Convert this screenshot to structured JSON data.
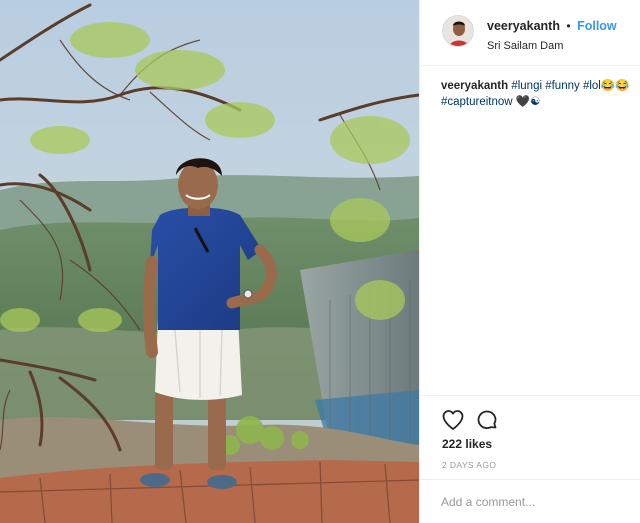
{
  "post": {
    "username": "veeryakanth",
    "separator": "•",
    "follow_label": "Follow",
    "location": "Sri Sailam Dam",
    "caption": {
      "username": "veeryakanth",
      "line1_tags": "#lungi #funny #lol😂😂",
      "line2_tags": "#captureitnow 🖤☯"
    },
    "likes": "222 likes",
    "date": "2 DAYS AGO",
    "comment_placeholder": "Add a comment..."
  },
  "icons": {
    "like": "heart-icon",
    "comment": "comment-bubble-icon"
  },
  "colors": {
    "link_blue": "#3897f0",
    "hashtag": "#003569",
    "muted": "#999999",
    "divider": "#efefef"
  }
}
